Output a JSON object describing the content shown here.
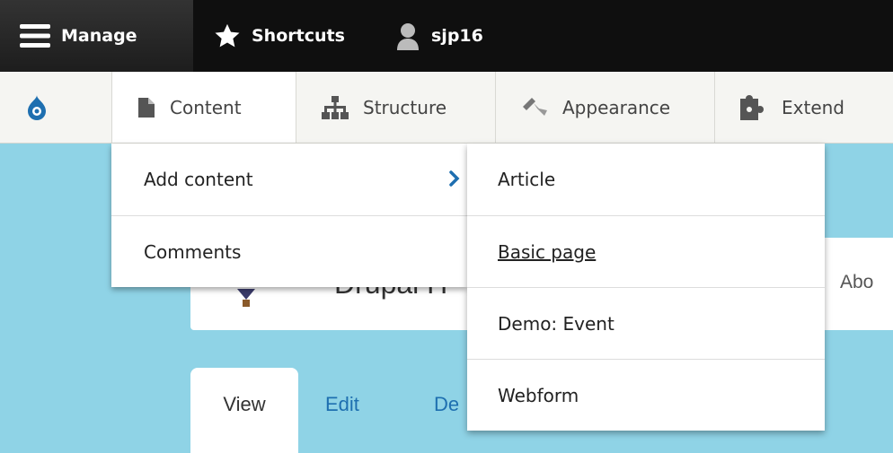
{
  "toolbar": {
    "manage_label": "Manage",
    "shortcuts_label": "Shortcuts",
    "user_label": "sjp16"
  },
  "tray": {
    "items": [
      {
        "label": "Content",
        "icon": "content-icon"
      },
      {
        "label": "Structure",
        "icon": "structure-icon"
      },
      {
        "label": "Appearance",
        "icon": "appearance-icon"
      },
      {
        "label": "Extend",
        "icon": "extend-icon"
      }
    ]
  },
  "content_menu": {
    "items": [
      {
        "label": "Add content"
      },
      {
        "label": "Comments"
      }
    ]
  },
  "add_content_menu": {
    "items": [
      {
        "label": "Article"
      },
      {
        "label": "Basic page"
      },
      {
        "label": "Demo: Event"
      },
      {
        "label": "Webform"
      }
    ]
  },
  "page": {
    "site_name": "Drupal H",
    "about_link": "Abo",
    "tabs": [
      {
        "label": "View"
      },
      {
        "label": "Edit"
      },
      {
        "label": "De"
      }
    ]
  },
  "colors": {
    "accent": "#1e6fb0",
    "toolbar_bg": "#0f0f0f",
    "page_bg": "#8fd3e6"
  }
}
